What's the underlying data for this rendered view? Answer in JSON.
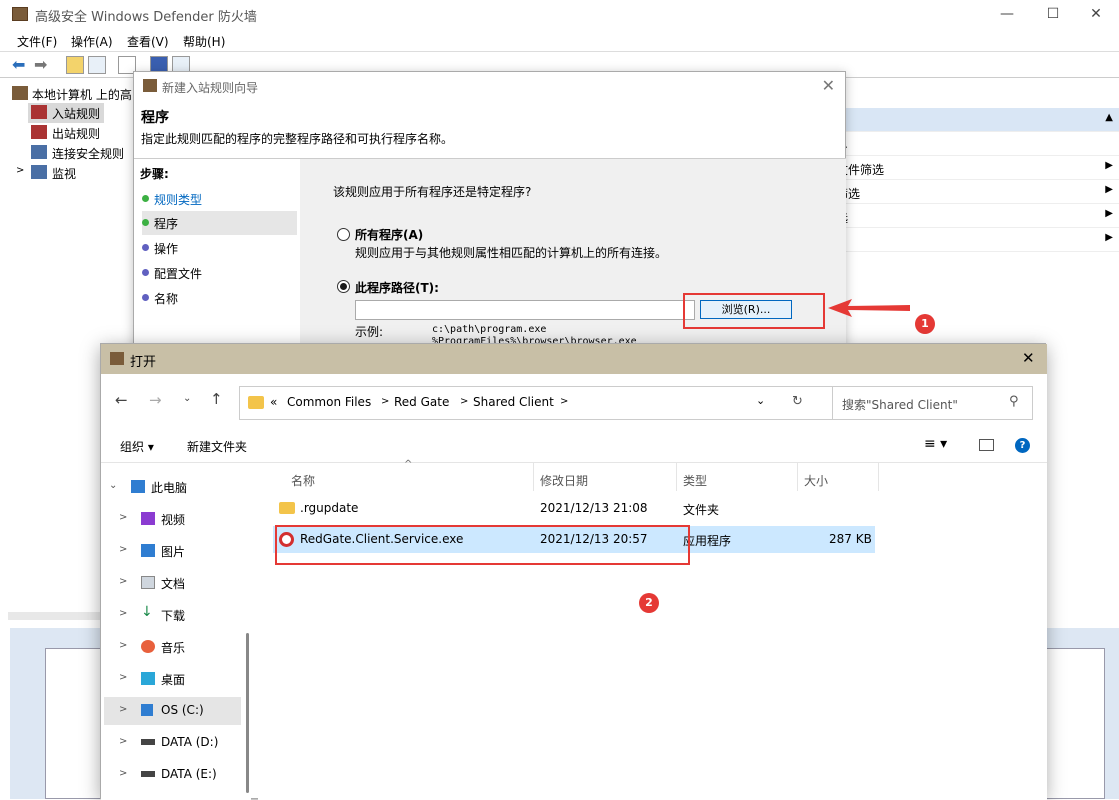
{
  "main": {
    "title": "高级安全 Windows Defender 防火墙",
    "minimize": "—",
    "maximize": "☐",
    "close": "✕",
    "menu": [
      "文件(F)",
      "操作(A)",
      "查看(V)",
      "帮助(H)"
    ],
    "tree": {
      "root": "本地计算机 上的高",
      "items": [
        "入站规则",
        "出站规则",
        "连接安全规则",
        "监视"
      ]
    },
    "right_panel": {
      "rows": [
        {
          "label": "",
          "arrow": ""
        },
        {
          "label": "…",
          "arrow": ""
        },
        {
          "label": "文件筛选",
          "arrow": "▶"
        },
        {
          "label": "筛选",
          "arrow": "▶"
        },
        {
          "label": "选",
          "arrow": "▶"
        },
        {
          "label": "",
          "arrow": "▶"
        }
      ]
    }
  },
  "wizard": {
    "title": "新建入站规则向导",
    "close": "✕",
    "heading": "程序",
    "description": "指定此规则匹配的程序的完整程序路径和可执行程序名称。",
    "steps_header": "步骤:",
    "steps": [
      "规则类型",
      "程序",
      "操作",
      "配置文件",
      "名称"
    ],
    "question": "该规则应用于所有程序还是特定程序?",
    "option_all": {
      "label": "所有程序(A)",
      "desc": "规则应用于与其他规则属性相匹配的计算机上的所有连接。"
    },
    "option_path": {
      "label": "此程序路径(T):"
    },
    "path_value": "",
    "browse_button": "浏览(R)...",
    "example_label": "示例:",
    "example_1": "c:\\path\\program.exe",
    "example_2": "%ProgramFiles%\\browser\\browser.exe"
  },
  "open_dialog": {
    "title": "打开",
    "close": "✕",
    "breadcrumb": [
      "«",
      "Common Files",
      "Red Gate",
      "Shared Client"
    ],
    "search_placeholder": "搜索\"Shared Client\"",
    "organize": "组织 ▾",
    "new_folder": "新建文件夹",
    "nav": [
      {
        "label": "此电脑",
        "chev": "⌄"
      },
      {
        "label": "视频",
        "chev": ">"
      },
      {
        "label": "图片",
        "chev": ">"
      },
      {
        "label": "文档",
        "chev": ">"
      },
      {
        "label": "下载",
        "chev": ">"
      },
      {
        "label": "音乐",
        "chev": ">"
      },
      {
        "label": "桌面",
        "chev": ">"
      },
      {
        "label": "OS (C:)",
        "chev": ">"
      },
      {
        "label": "DATA (D:)",
        "chev": ">"
      },
      {
        "label": "DATA (E:)",
        "chev": ">"
      }
    ],
    "columns": [
      "名称",
      "修改日期",
      "类型",
      "大小"
    ],
    "files": [
      {
        "name": ".rgupdate",
        "date": "2021/12/13 21:08",
        "type": "文件夹",
        "size": ""
      },
      {
        "name": "RedGate.Client.Service.exe",
        "date": "2021/12/13 20:57",
        "type": "应用程序",
        "size": "287 KB"
      }
    ]
  },
  "annotations": {
    "badge1": "1",
    "badge2": "2"
  },
  "colors": {
    "accent": "#0067c0",
    "red": "#e53935",
    "selected_row": "#cce8ff",
    "title_bar": "#c8bfa6"
  }
}
